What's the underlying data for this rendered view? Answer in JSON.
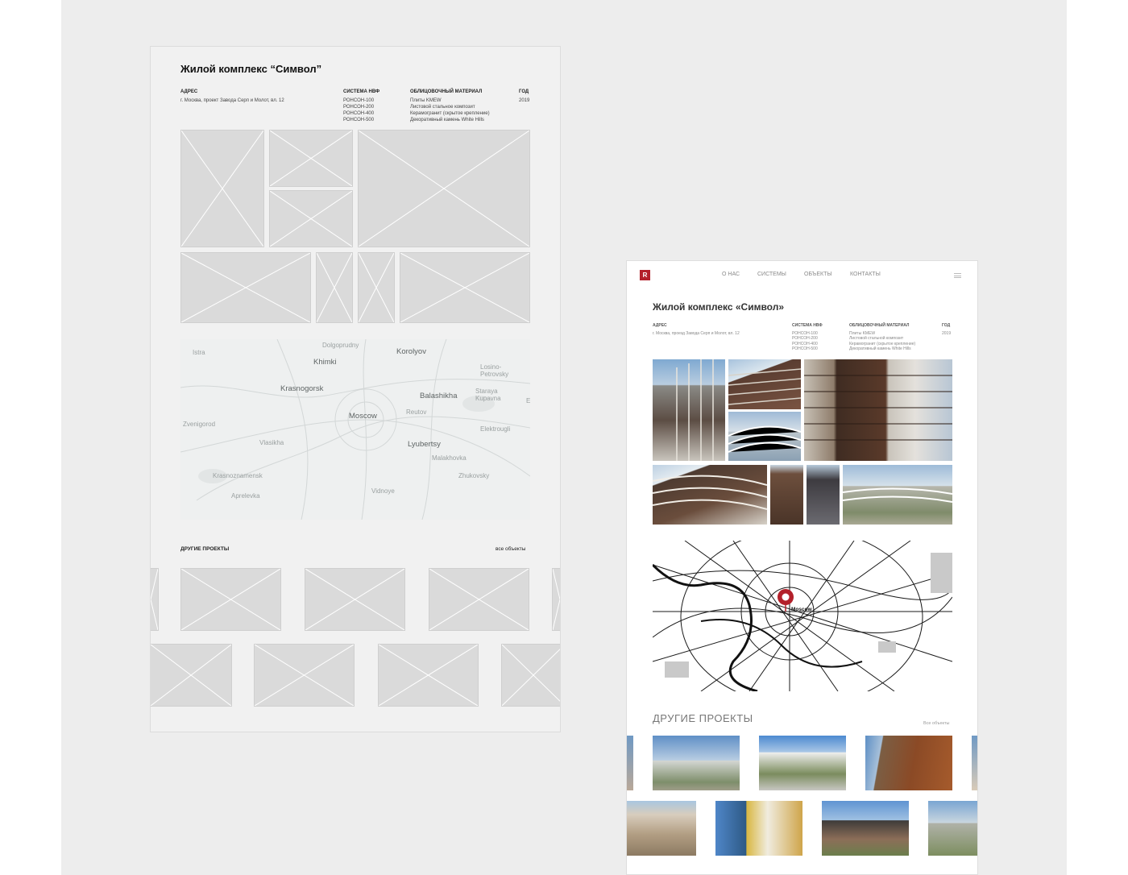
{
  "wireframe": {
    "title": "Жилой комплекс “Символ”",
    "specs": {
      "address_label": "АДРЕС",
      "address_value": "г. Москва, проект Завода Серп и Молот, вл. 12",
      "system_label": "СИСТЕМА НВФ",
      "systems": [
        "РОНСОН-100",
        "РОНСОН-200",
        "РОНСОН-400",
        "РОНСОН-500"
      ],
      "material_label": "ОБЛИЦОВОЧНЫЙ МАТЕРИАЛ",
      "materials": [
        "Плиты KMEW",
        "Листовой стальное композит",
        "Керамогранит (скрытое крепление)",
        "Декоративный камень White Hills"
      ],
      "year_label": "ГОД",
      "year_value": "2019"
    },
    "map_labels": [
      "Dolgoprudny",
      "Korolyov",
      "Istra",
      "Khimki",
      "Losino-Petrovsky",
      "Krasnogorsk",
      "Balashikha",
      "Staraya Kupavna",
      "Moscow",
      "Reutov",
      "Zvenigorod",
      "Elektrougli",
      "Vlasikha",
      "Lyubertsy",
      "Malakhovka",
      "Krasnoznamensk",
      "Zhukovsky",
      "Aprelevka",
      "Vidnoye",
      "E"
    ],
    "other_projects_label": "ДРУГИЕ ПРОЕКТЫ",
    "all_objects_link": "все объекты"
  },
  "design": {
    "logo_glyph": "R",
    "nav": [
      "О НАС",
      "СИСТЕМЫ",
      "ОБЪЕКТЫ",
      "КОНТАКТЫ"
    ],
    "title": "Жилой комплекс «Символ»",
    "specs": {
      "address_label": "АДРЕС",
      "address_value": "г. Москва, проезд Завода Серп и Молот, вл. 12",
      "system_label": "СИСТЕМА НВФ",
      "systems": [
        "РОНСОН-100",
        "РОНСОН-200",
        "РОНСОН-400",
        "РОНСОН-500"
      ],
      "material_label": "ОБЛИЦОВОЧНЫЙ МАТЕРИАЛ",
      "materials": [
        "Плиты KMEW",
        "Листовой стальной композит",
        "Керамогранит (скрытое крепление)",
        "Декоративный камень White Hills"
      ],
      "year_label": "ГОД",
      "year_value": "2019"
    },
    "map_city_label": "Moscow",
    "other_projects_label": "ДРУГИЕ ПРОЕКТЫ",
    "all_objects_link": "Все объекты",
    "accent_color": "#b3202a"
  }
}
